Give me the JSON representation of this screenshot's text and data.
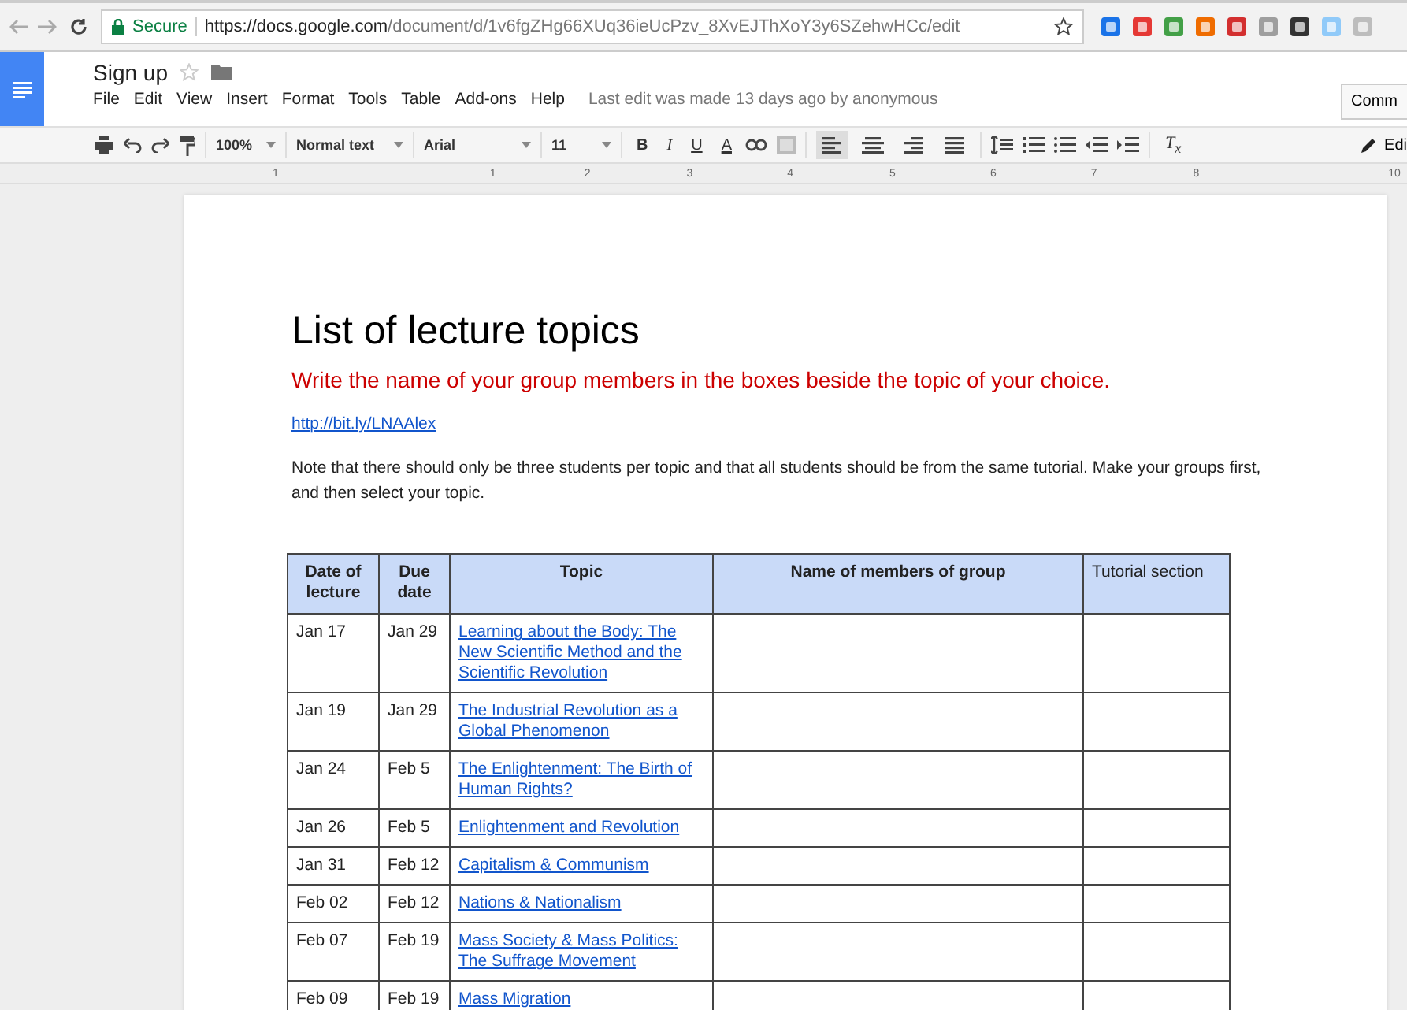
{
  "browser": {
    "secure_label": "Secure",
    "url_host": "https://docs.google.com",
    "url_path": "/document/d/1v6fgZHg66XUq36ieUcPzv_8XvEJThXoY3y6SZehwHCc/edit"
  },
  "docs_header": {
    "title": "Sign up",
    "menu": [
      "File",
      "Edit",
      "View",
      "Insert",
      "Format",
      "Tools",
      "Table",
      "Add-ons",
      "Help"
    ],
    "last_edit": "Last edit was made 13 days ago by anonymous",
    "comments_button": "Comm",
    "editing_button": "Edi"
  },
  "toolbar": {
    "zoom": "100%",
    "style": "Normal text",
    "font": "Arial",
    "size": "11",
    "bold": "B",
    "italic": "I",
    "underline": "U",
    "text_color": "A",
    "alignments": [
      {
        "kind": "left",
        "selected": true
      },
      {
        "kind": "center",
        "selected": false
      },
      {
        "kind": "right",
        "selected": false
      },
      {
        "kind": "justify",
        "selected": false
      }
    ],
    "clear_format": "T$_{x}$"
  },
  "ruler": {
    "labels": [
      "1",
      "1",
      "2",
      "3",
      "4",
      "5",
      "6",
      "7",
      "8",
      "10"
    ]
  },
  "document": {
    "heading": "List of lecture topics",
    "instruction": "Write the name of your group members in the boxes beside the topic of your choice.",
    "link": "http://bit.ly/LNAAlex",
    "note": "Note that there should only be three students per topic and that all students should be from the same tutorial. Make your groups first, and then select your topic.",
    "table": {
      "columns": [
        {
          "label": "Date of lecture",
          "bold": true
        },
        {
          "label": "Due date",
          "bold": true
        },
        {
          "label": "Topic",
          "bold": true
        },
        {
          "label": "Name of members of group",
          "bold": true
        },
        {
          "label": "Tutorial section",
          "bold": false
        }
      ],
      "rows": [
        {
          "date": "Jan 17",
          "due": "Jan 29",
          "topic": "Learning about the Body: The New Scientific Method and the Scientific Revolution"
        },
        {
          "date": "Jan 19",
          "due": "Jan 29",
          "topic": "The Industrial Revolution as a Global Phenomenon"
        },
        {
          "date": "Jan 24",
          "due": "Feb 5",
          "topic": "The Enlightenment: The Birth of Human Rights?"
        },
        {
          "date": "Jan 26",
          "due": "Feb 5",
          "topic": "Enlightenment and Revolution"
        },
        {
          "date": "Jan 31",
          "due": "Feb 12",
          "topic": "Capitalism & Communism"
        },
        {
          "date": "Feb 02",
          "due": "Feb 12",
          "topic": "Nations & Nationalism"
        },
        {
          "date": "Feb 07",
          "due": "Feb 19",
          "topic": "Mass Society & Mass Politics: The Suffrage Movement"
        },
        {
          "date": "Feb 09",
          "due": "Feb 19",
          "topic": "Mass Migration"
        }
      ]
    }
  }
}
